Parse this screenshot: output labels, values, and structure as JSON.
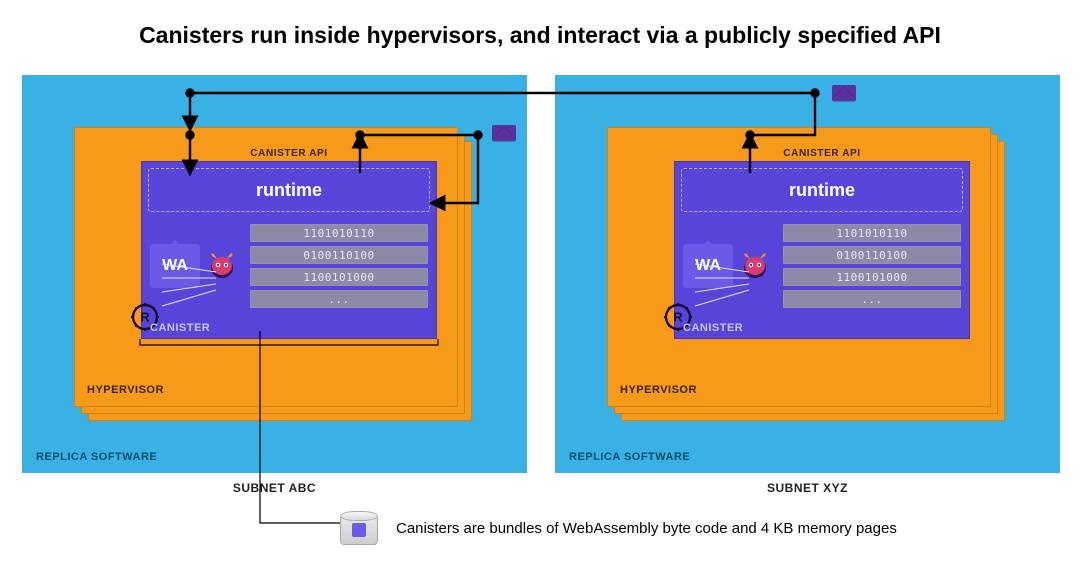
{
  "title": "Canisters run inside hypervisors, and interact via a publicly specified API",
  "subnets": [
    {
      "name": "SUBNET ABC",
      "replica_label": "REPLICA SOFTWARE",
      "hypervisor_label": "HYPERVISOR"
    },
    {
      "name": "SUBNET XYZ",
      "replica_label": "REPLICA SOFTWARE",
      "hypervisor_label": "HYPERVISOR"
    }
  ],
  "canister": {
    "api_label": "CANISTER API",
    "runtime_label": "runtime",
    "label": "CANISTER",
    "wa_label": "WA",
    "memory_rows": [
      "1101010110",
      "0100110100",
      "1100101000",
      "..."
    ]
  },
  "icons": {
    "motoko": "motoko-icon",
    "rust": "rust-icon",
    "mail": "mail-icon",
    "storage": "storage-drum-icon"
  },
  "footnote": "Canisters are bundles of WebAssembly byte code and 4 KB memory pages"
}
